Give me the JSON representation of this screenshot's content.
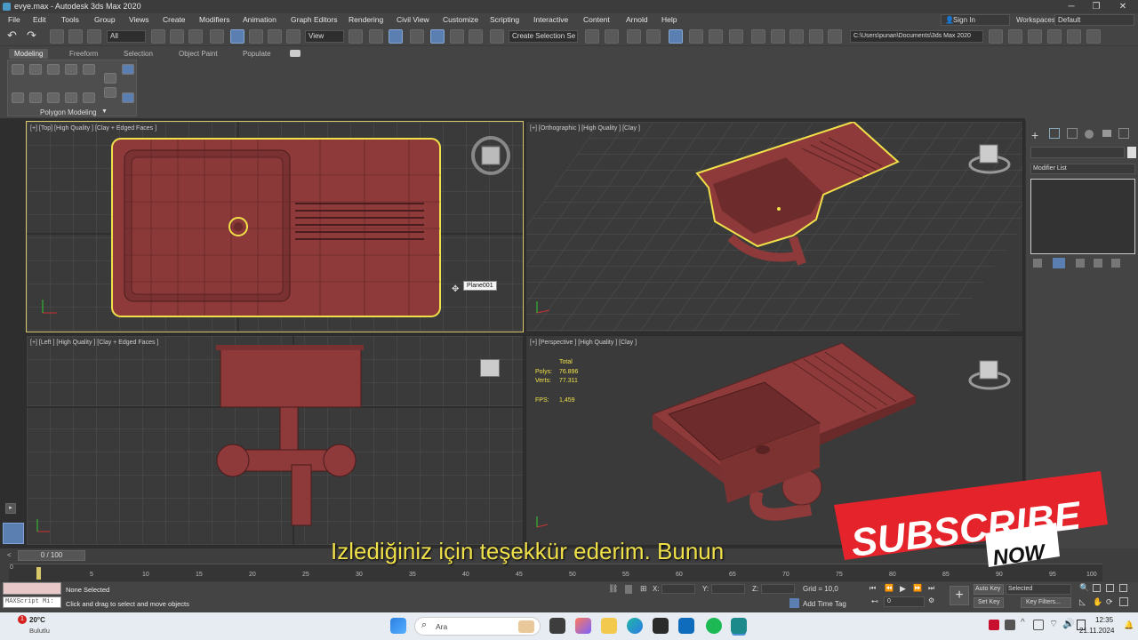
{
  "window": {
    "title": "evye.max - Autodesk 3ds Max 2020",
    "minimize": "─",
    "maximize": "❐",
    "close": "✕"
  },
  "menu": [
    "File",
    "Edit",
    "Tools",
    "Group",
    "Views",
    "Create",
    "Modifiers",
    "Animation",
    "Graph Editors",
    "Rendering",
    "Civil View",
    "Customize",
    "Scripting",
    "Interactive",
    "Content",
    "Arnold",
    "Help"
  ],
  "account": {
    "sign_in": "Sign In",
    "workspaces_label": "Workspaces:",
    "workspace_value": "Default"
  },
  "toolbar": {
    "selection_filter": "All",
    "ref_coord": "View",
    "named_selection": "Create Selection Se",
    "project_path": "C:\\Users\\punan\\Documents\\3ds Max 2020"
  },
  "ribbon": {
    "tabs": [
      "Modeling",
      "Freeform",
      "Selection",
      "Object Paint",
      "Populate"
    ],
    "panel_label": "Polygon Modeling"
  },
  "viewports": {
    "top": {
      "label": "[+] [Top] [High Quality ] [Clay + Edged Faces ]",
      "tooltip": "Plane001"
    },
    "ortho": {
      "label": "[+] [Orthographic ] [High Quality ] [Clay ]"
    },
    "left": {
      "label": "[+] [Left ] [High Quality ] [Clay + Edged Faces ]"
    },
    "persp": {
      "label": "[+] [Perspective ] [High Quality ] [Clay ]",
      "stats_total": "Total",
      "polys_label": "Polys:",
      "polys_value": "76.896",
      "verts_label": "Verts:",
      "verts_value": "77.311",
      "fps_label": "FPS:",
      "fps_value": "1,459"
    }
  },
  "command_panel": {
    "modifier_list": "Modifier List"
  },
  "timeline": {
    "frame_counter": "0 / 100",
    "ticks": [
      "0",
      "5",
      "10",
      "15",
      "20",
      "25",
      "30",
      "35",
      "40",
      "45",
      "50",
      "55",
      "60",
      "65",
      "70",
      "75",
      "80",
      "85",
      "90",
      "95",
      "100"
    ]
  },
  "status": {
    "maxscript": "MAXScript Mi:",
    "selection": "None Selected",
    "prompt": "Click and drag to select and move objects",
    "x_label": "X:",
    "y_label": "Y:",
    "z_label": "Z:",
    "grid": "Grid = 10,0",
    "add_time_tag": "Add Time Tag",
    "auto_key": "Auto Key",
    "set_key": "Set Key",
    "selected_dropdown": "Selected",
    "key_filters": "Key Filters...",
    "frame_value": "0"
  },
  "subtitle": "Izlediğiniz için teşekkür ederim. Bunun",
  "subscribe": {
    "line1": "SUBSCRIBE",
    "line2": "NOW"
  },
  "taskbar": {
    "weather_temp": "20°C",
    "weather_place": "Bulutlu",
    "search": "Ara",
    "time": "12:35",
    "date": "21.11.2024",
    "badge": "1"
  },
  "colors": {
    "accent": "#5a7fb0",
    "selection": "#f0e04a",
    "model": "#8e3a3a",
    "subscribe_red": "#e4232b"
  }
}
